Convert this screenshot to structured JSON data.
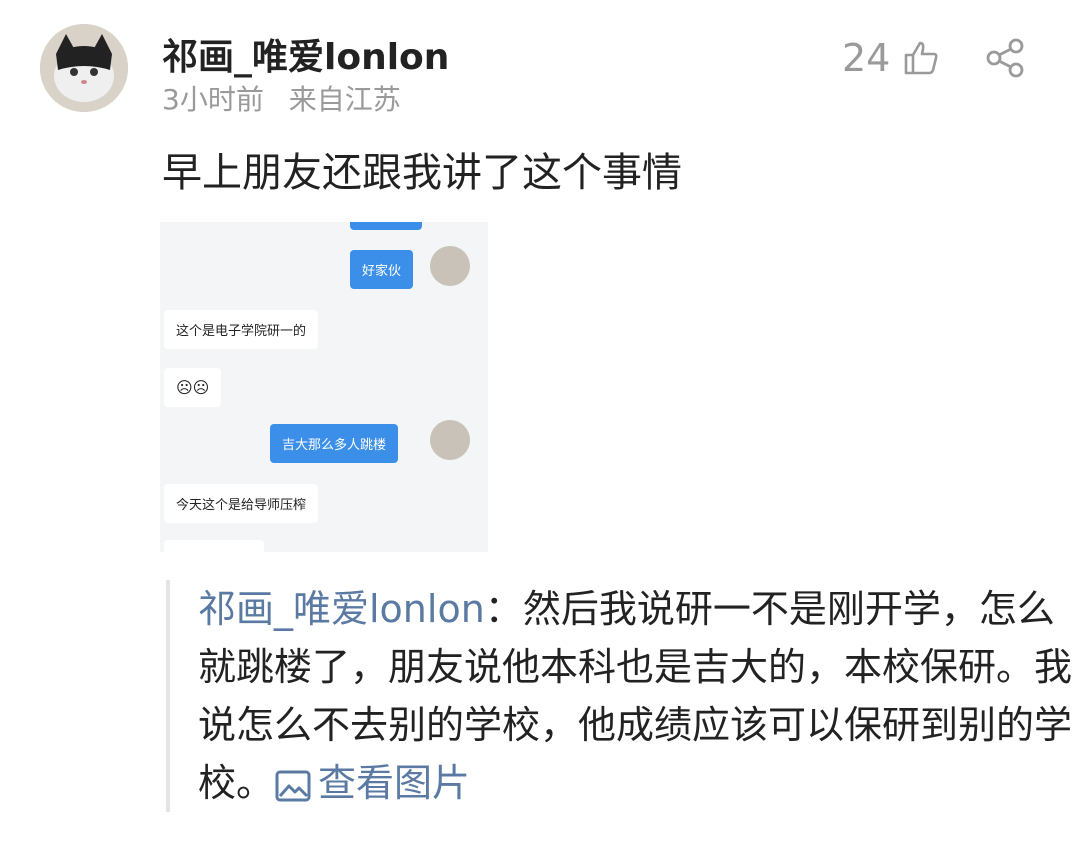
{
  "post": {
    "username": "祁画_唯爱lonlon",
    "time": "3小时前",
    "location": "来自江苏",
    "likes": "24",
    "text": "早上朋友还跟我讲了这个事情"
  },
  "screenshot": {
    "messages": [
      {
        "side": "me",
        "text": "好家伙"
      },
      {
        "side": "them",
        "text": "这个是电子学院研一的"
      },
      {
        "side": "them",
        "text": "☹☹"
      },
      {
        "side": "me",
        "text": "吉大那么多人跳楼"
      },
      {
        "side": "them",
        "text": "今天这个是给导师压榨"
      }
    ]
  },
  "reply": {
    "author": "祁画_唯爱lonlon",
    "sep": "：",
    "text": "然后我说研一不是刚开学，怎么就跳楼了，朋友说他本科也是吉大的，本校保研。我说怎么不去别的学校，他成绩应该可以保研到别的学校。",
    "view_image": "查看图片"
  },
  "icons": {
    "like": "thumb-up-icon",
    "share": "share-icon",
    "image": "image-icon"
  },
  "colors": {
    "link": "#5b7aa3",
    "bubble_me": "#3b8fe8",
    "meta": "#9a9a9a"
  }
}
